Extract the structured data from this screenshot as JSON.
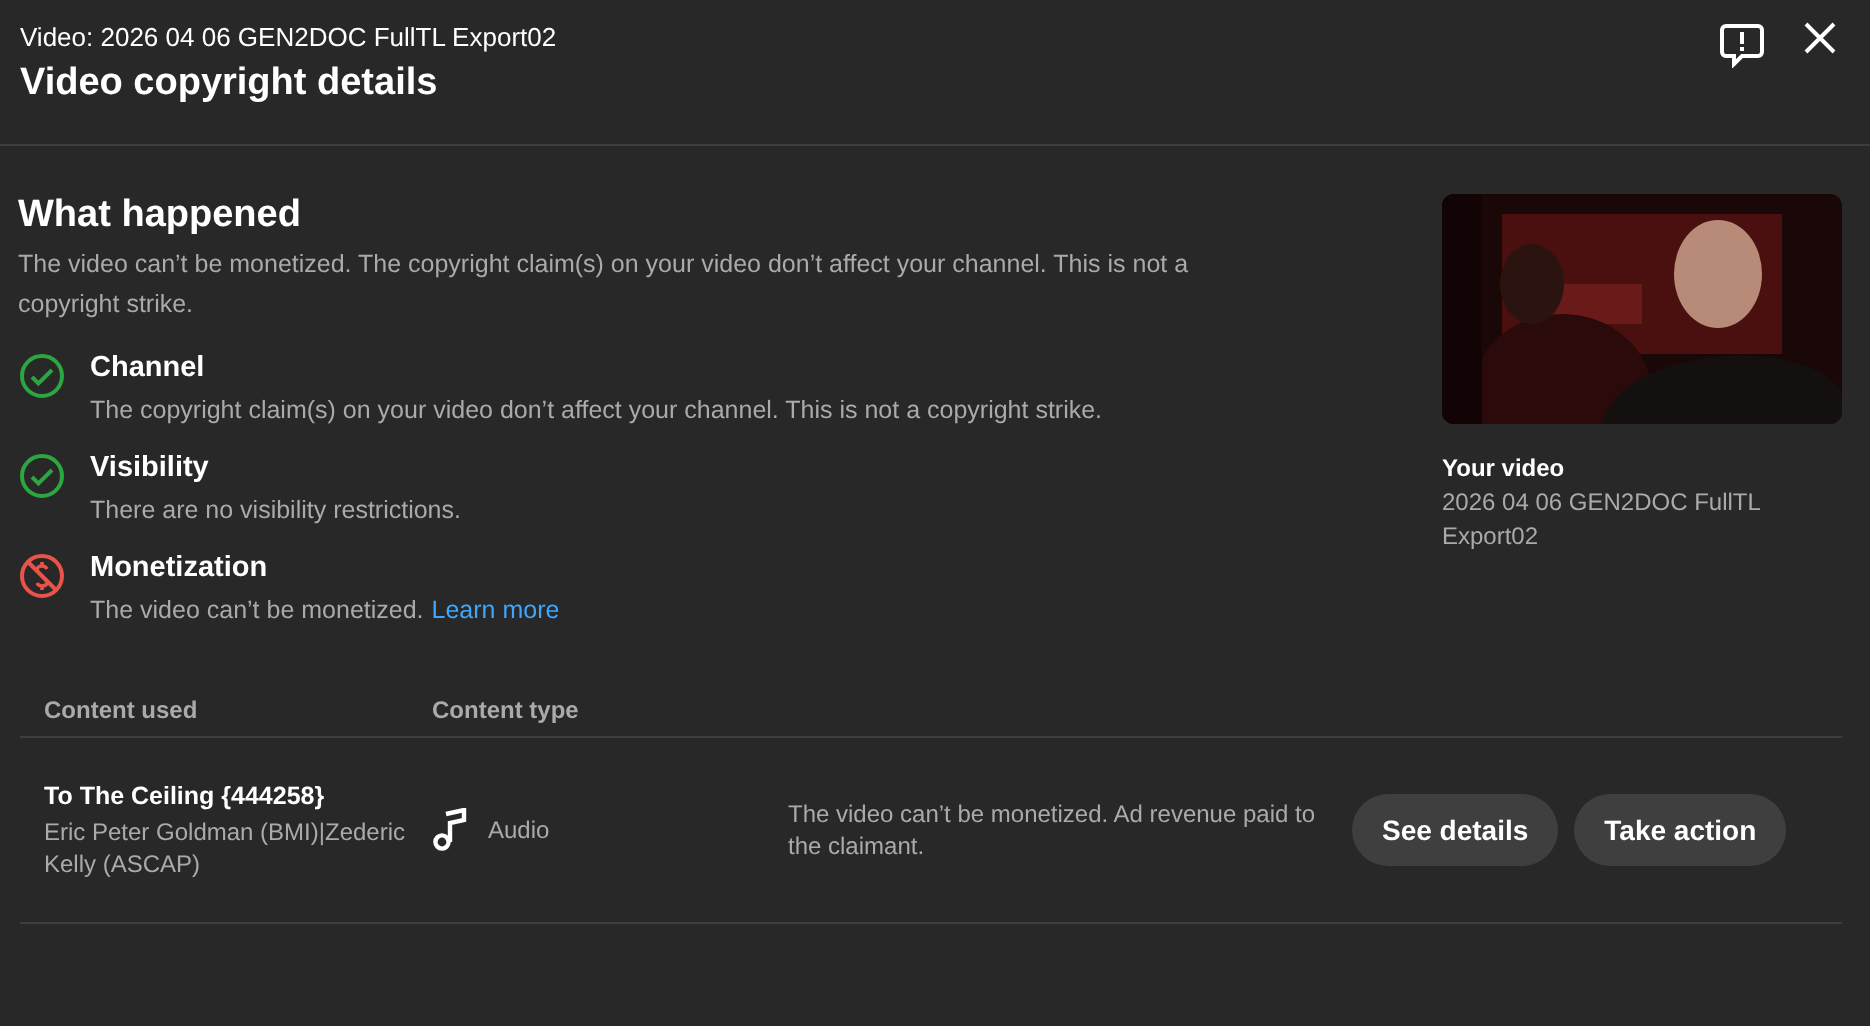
{
  "header": {
    "subtitle": "Video: 2026 04 06 GEN2DOC FullTL Export02",
    "title": "Video copyright details"
  },
  "summary": {
    "heading": "What happened",
    "text": "The video can’t be monetized. The copyright claim(s) on your video don’t affect your channel. This is not a copyright strike.",
    "items": [
      {
        "kind": "ok",
        "title": "Channel",
        "text": "The copyright claim(s) on your video don’t affect your channel. This is not a copyright strike."
      },
      {
        "kind": "ok",
        "title": "Visibility",
        "text": "There are no visibility restrictions."
      },
      {
        "kind": "blocked",
        "title": "Monetization",
        "text": "The video can’t be monetized.",
        "link": "Learn more"
      }
    ]
  },
  "video": {
    "kind": "picture",
    "label": "Your video",
    "name": "2026 04 06 GEN2DOC FullTL Export02"
  },
  "table": {
    "columns": [
      "Content used",
      "Content type"
    ],
    "rows": [
      {
        "title": "To The Ceiling {444258}",
        "owners": "Eric Peter Goldman (BMI)|Zederic Kelly (ASCAP)",
        "type": "Audio",
        "impact": "The video can’t be monetized. Ad revenue paid to the claimant.",
        "actions": [
          "See details",
          "Take action"
        ]
      }
    ]
  }
}
